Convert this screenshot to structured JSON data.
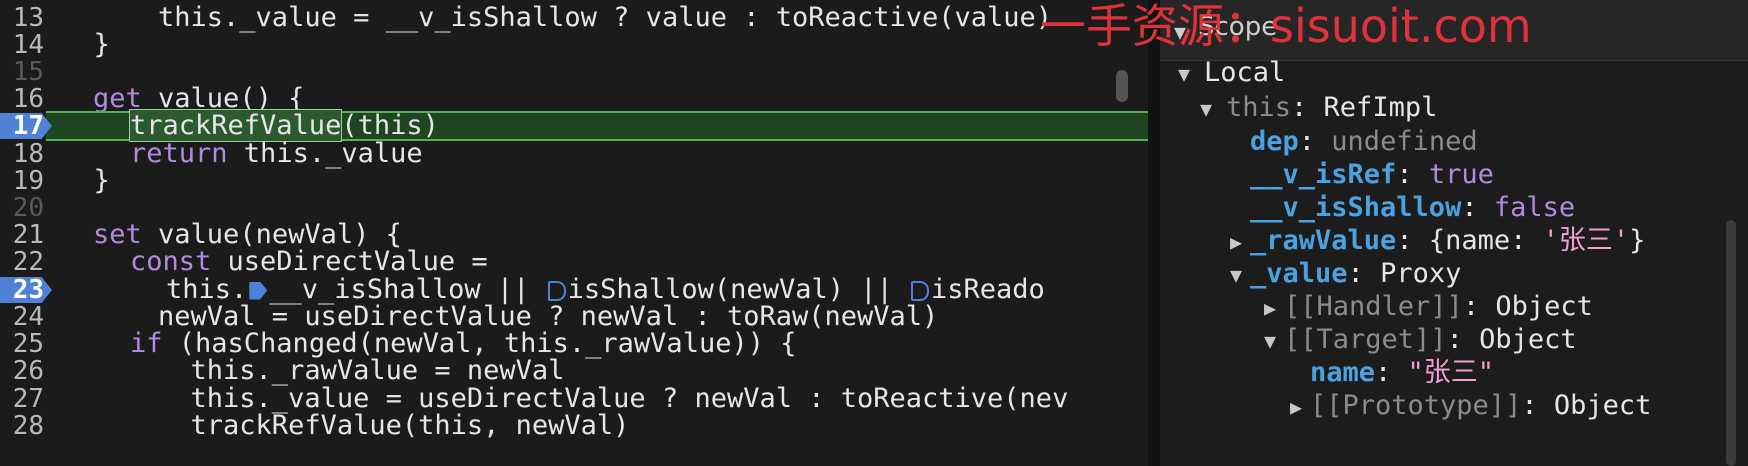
{
  "editor": {
    "lines": [
      {
        "num": "13",
        "text": "    this._value = __v_isShallow ? value : toReactive(value)"
      },
      {
        "num": "14",
        "text": "  }"
      },
      {
        "num": "15",
        "text": ""
      },
      {
        "num": "16",
        "kw": "get",
        "rest": " value() {"
      },
      {
        "num": "17",
        "sel": "trackRefValue",
        "rest": "(this)"
      },
      {
        "num": "18",
        "kw": "return",
        "rest": " this._value"
      },
      {
        "num": "19",
        "text": "  }"
      },
      {
        "num": "20",
        "text": ""
      },
      {
        "num": "21",
        "kw": "set",
        "rest": " value(newVal) {"
      },
      {
        "num": "22",
        "kw": "const",
        "rest": " useDirectValue ="
      },
      {
        "num": "23",
        "a": "this.",
        "b": "__v_isShallow || ",
        "c": "isShallow(newVal) || ",
        "d": "isReado"
      },
      {
        "num": "24",
        "text": "    newVal = useDirectValue ? newVal : toRaw(newVal)"
      },
      {
        "num": "25",
        "kw": "if",
        "rest": " (hasChanged(newVal, this._rawValue)) {"
      },
      {
        "num": "26",
        "text": "      this._rawValue = newVal"
      },
      {
        "num": "27",
        "text": "      this._value = useDirectValue ? newVal : toReactive(nev"
      },
      {
        "num": "28",
        "text": "      trackRefValue(this, newVal)"
      }
    ]
  },
  "scope": {
    "title": "Scope",
    "local_label": "Local",
    "this_label": "this",
    "this_type": "RefImpl",
    "dep_key": "dep",
    "dep_val": "undefined",
    "isref_key": "__v_isRef",
    "isref_val": "true",
    "isshallow_key": "__v_isShallow",
    "isshallow_val": "false",
    "rawvalue_key": "_rawValue",
    "rawvalue_open": "{name: ",
    "rawvalue_str": "'张三'",
    "rawvalue_close": "}",
    "value_key": "_value",
    "value_type": "Proxy",
    "handler_key": "[[Handler]]",
    "handler_type": "Object",
    "target_key": "[[Target]]",
    "target_type": "Object",
    "name_key": "name",
    "name_val": "\"张三\"",
    "proto_key": "[[Prototype]]",
    "proto_type": "Object"
  },
  "watermark": "一手资源：sisuoit.com",
  "colors": {
    "keyword": "#b28be0",
    "property": "#4aa3e0",
    "string": "#f2a0d0",
    "breakpoint": "#4d82d6",
    "highlight": "#1f4620",
    "watermark": "#e0323a"
  }
}
